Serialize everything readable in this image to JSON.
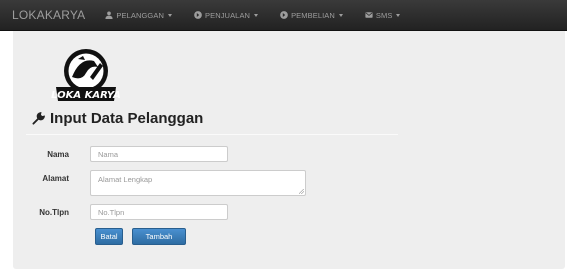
{
  "navbar": {
    "brand": "LOKAKARYA",
    "items": [
      {
        "label": "PELANGGAN",
        "icon": "user-icon"
      },
      {
        "label": "PENJUALAN",
        "icon": "circle-arrow-icon"
      },
      {
        "label": "PEMBELIAN",
        "icon": "circle-arrow-icon"
      },
      {
        "label": "SMS",
        "icon": "sms-icon"
      }
    ]
  },
  "logo": {
    "text": "LOKA KARYA",
    "icon": "logo-emblem"
  },
  "page": {
    "title": "Input Data Pelanggan",
    "title_icon": "wrench-icon"
  },
  "form": {
    "nama": {
      "label": "Nama",
      "placeholder": "Nama",
      "value": ""
    },
    "alamat": {
      "label": "Alamat",
      "placeholder": "Alamat Lengkap",
      "value": ""
    },
    "notlp": {
      "label": "No.Tlpn",
      "placeholder": "No.Tlpn",
      "value": ""
    }
  },
  "buttons": {
    "cancel": "Batal",
    "submit": "Tambah"
  },
  "colors": {
    "navbar": "#222222",
    "panel": "#eeeeee",
    "primary": "#337ab7"
  }
}
